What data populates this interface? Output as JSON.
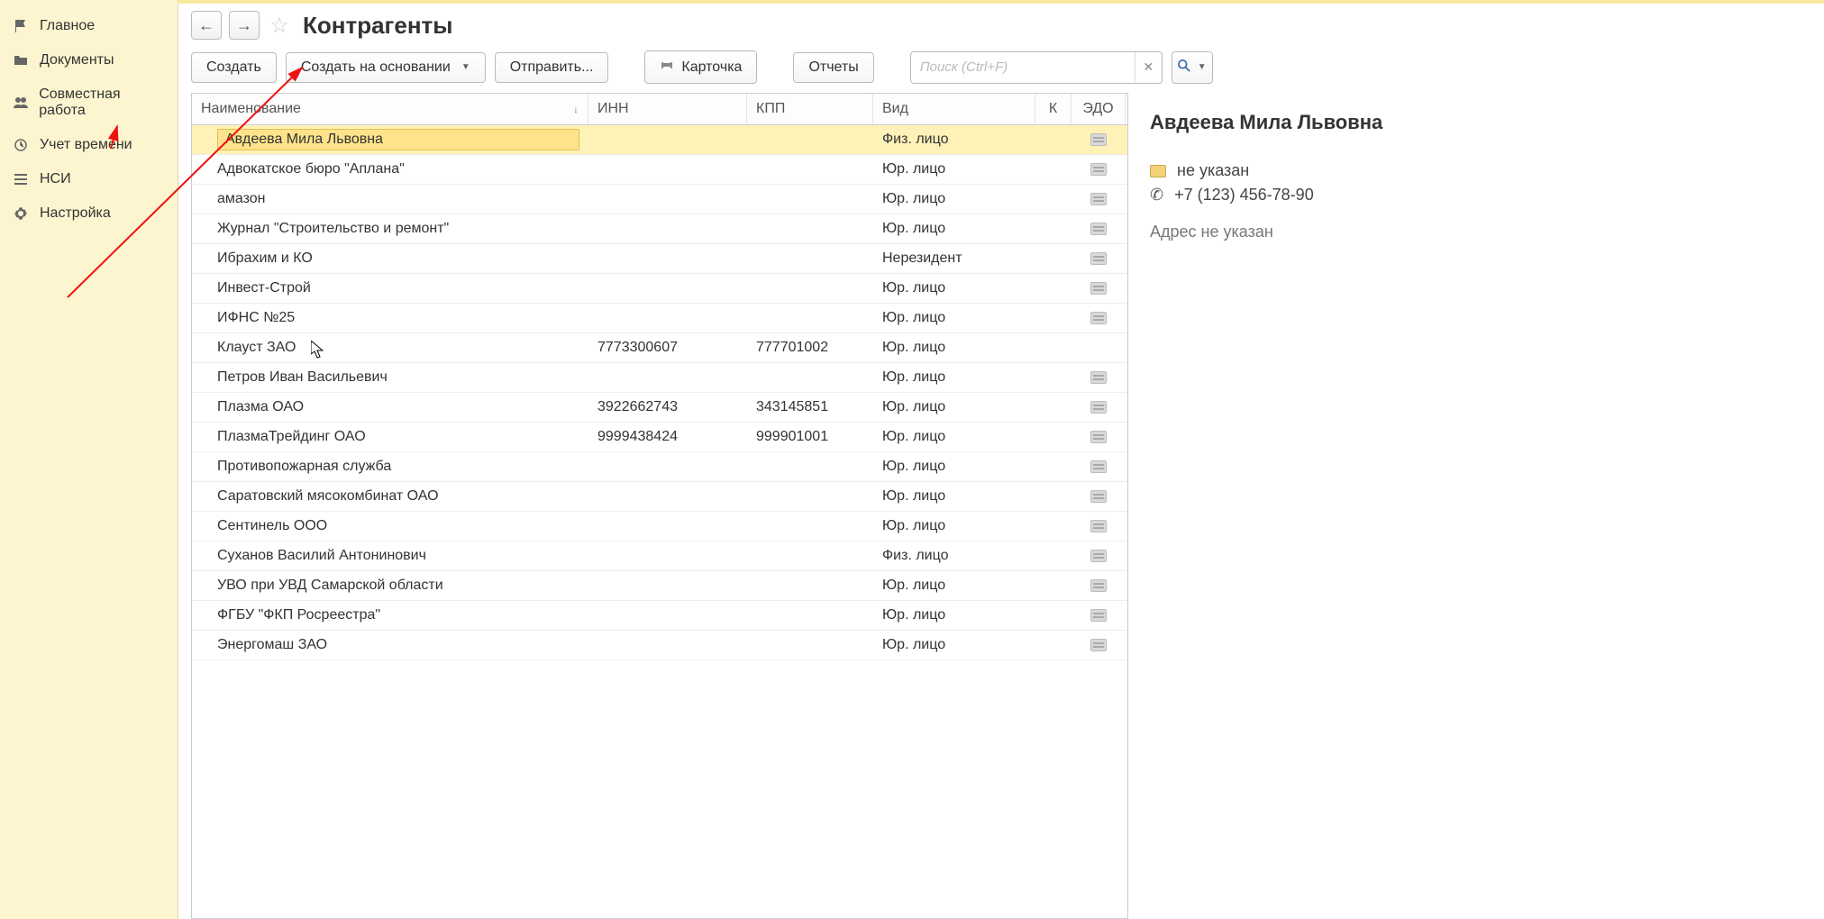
{
  "sidebar": {
    "items": [
      {
        "label": "Главное",
        "icon": "flag"
      },
      {
        "label": "Документы",
        "icon": "folder"
      },
      {
        "label": "Совместная работа",
        "icon": "people"
      },
      {
        "label": "Учет времени",
        "icon": "clock"
      },
      {
        "label": "НСИ",
        "icon": "list"
      },
      {
        "label": "Настройка",
        "icon": "gear"
      }
    ]
  },
  "header": {
    "title": "Контрагенты"
  },
  "toolbar": {
    "create": "Создать",
    "create_based": "Создать на основании",
    "send": "Отправить...",
    "card": "Карточка",
    "reports": "Отчеты",
    "search_placeholder": "Поиск (Ctrl+F)"
  },
  "columns": {
    "name": "Наименование",
    "inn": "ИНН",
    "kpp": "КПП",
    "kind": "Вид",
    "k": "К",
    "edo": "ЭДО"
  },
  "rows": [
    {
      "name": "Авдеева Мила Львовна",
      "inn": "",
      "kpp": "",
      "kind": "Физ. лицо",
      "edo": true,
      "selected": true
    },
    {
      "name": "Адвокатское бюро \"Аплана\"",
      "inn": "",
      "kpp": "",
      "kind": "Юр. лицо",
      "edo": true
    },
    {
      "name": "амазон",
      "inn": "",
      "kpp": "",
      "kind": "Юр. лицо",
      "edo": true
    },
    {
      "name": "Журнал \"Строительство и ремонт\"",
      "inn": "",
      "kpp": "",
      "kind": "Юр. лицо",
      "edo": true
    },
    {
      "name": "Ибрахим и КО",
      "inn": "",
      "kpp": "",
      "kind": "Нерезидент",
      "edo": true
    },
    {
      "name": "Инвест-Строй",
      "inn": "",
      "kpp": "",
      "kind": "Юр. лицо",
      "edo": true
    },
    {
      "name": "ИФНС №25",
      "inn": "",
      "kpp": "",
      "kind": "Юр. лицо",
      "edo": true
    },
    {
      "name": "Клауст ЗАО",
      "inn": "7773300607",
      "kpp": "777701002",
      "kind": "Юр. лицо",
      "edo": false
    },
    {
      "name": "Петров Иван Васильевич",
      "inn": "",
      "kpp": "",
      "kind": "Юр. лицо",
      "edo": true
    },
    {
      "name": "Плазма ОАО",
      "inn": "3922662743",
      "kpp": "343145851",
      "kind": "Юр. лицо",
      "edo": true
    },
    {
      "name": "ПлазмаТрейдинг ОАО",
      "inn": "9999438424",
      "kpp": "999901001",
      "kind": "Юр. лицо",
      "edo": true
    },
    {
      "name": "Противопожарная служба",
      "inn": "",
      "kpp": "",
      "kind": "Юр. лицо",
      "edo": true
    },
    {
      "name": "Саратовский мясокомбинат ОАО",
      "inn": "",
      "kpp": "",
      "kind": "Юр. лицо",
      "edo": true
    },
    {
      "name": "Сентинель ООО",
      "inn": "",
      "kpp": "",
      "kind": "Юр. лицо",
      "edo": true
    },
    {
      "name": "Суханов Василий Антонинович",
      "inn": "",
      "kpp": "",
      "kind": "Физ. лицо",
      "edo": true
    },
    {
      "name": "УВО при УВД Самарской области",
      "inn": "",
      "kpp": "",
      "kind": "Юр. лицо",
      "edo": true
    },
    {
      "name": "ФГБУ \"ФКП Росреестра\"",
      "inn": "",
      "kpp": "",
      "kind": "Юр. лицо",
      "edo": true
    },
    {
      "name": "Энергомаш ЗАО",
      "inn": "",
      "kpp": "",
      "kind": "Юр. лицо",
      "edo": true
    }
  ],
  "details": {
    "title": "Авдеева Мила Львовна",
    "folder": "не указан",
    "phone": "+7 (123) 456-78-90",
    "address": "Адрес не указан"
  }
}
